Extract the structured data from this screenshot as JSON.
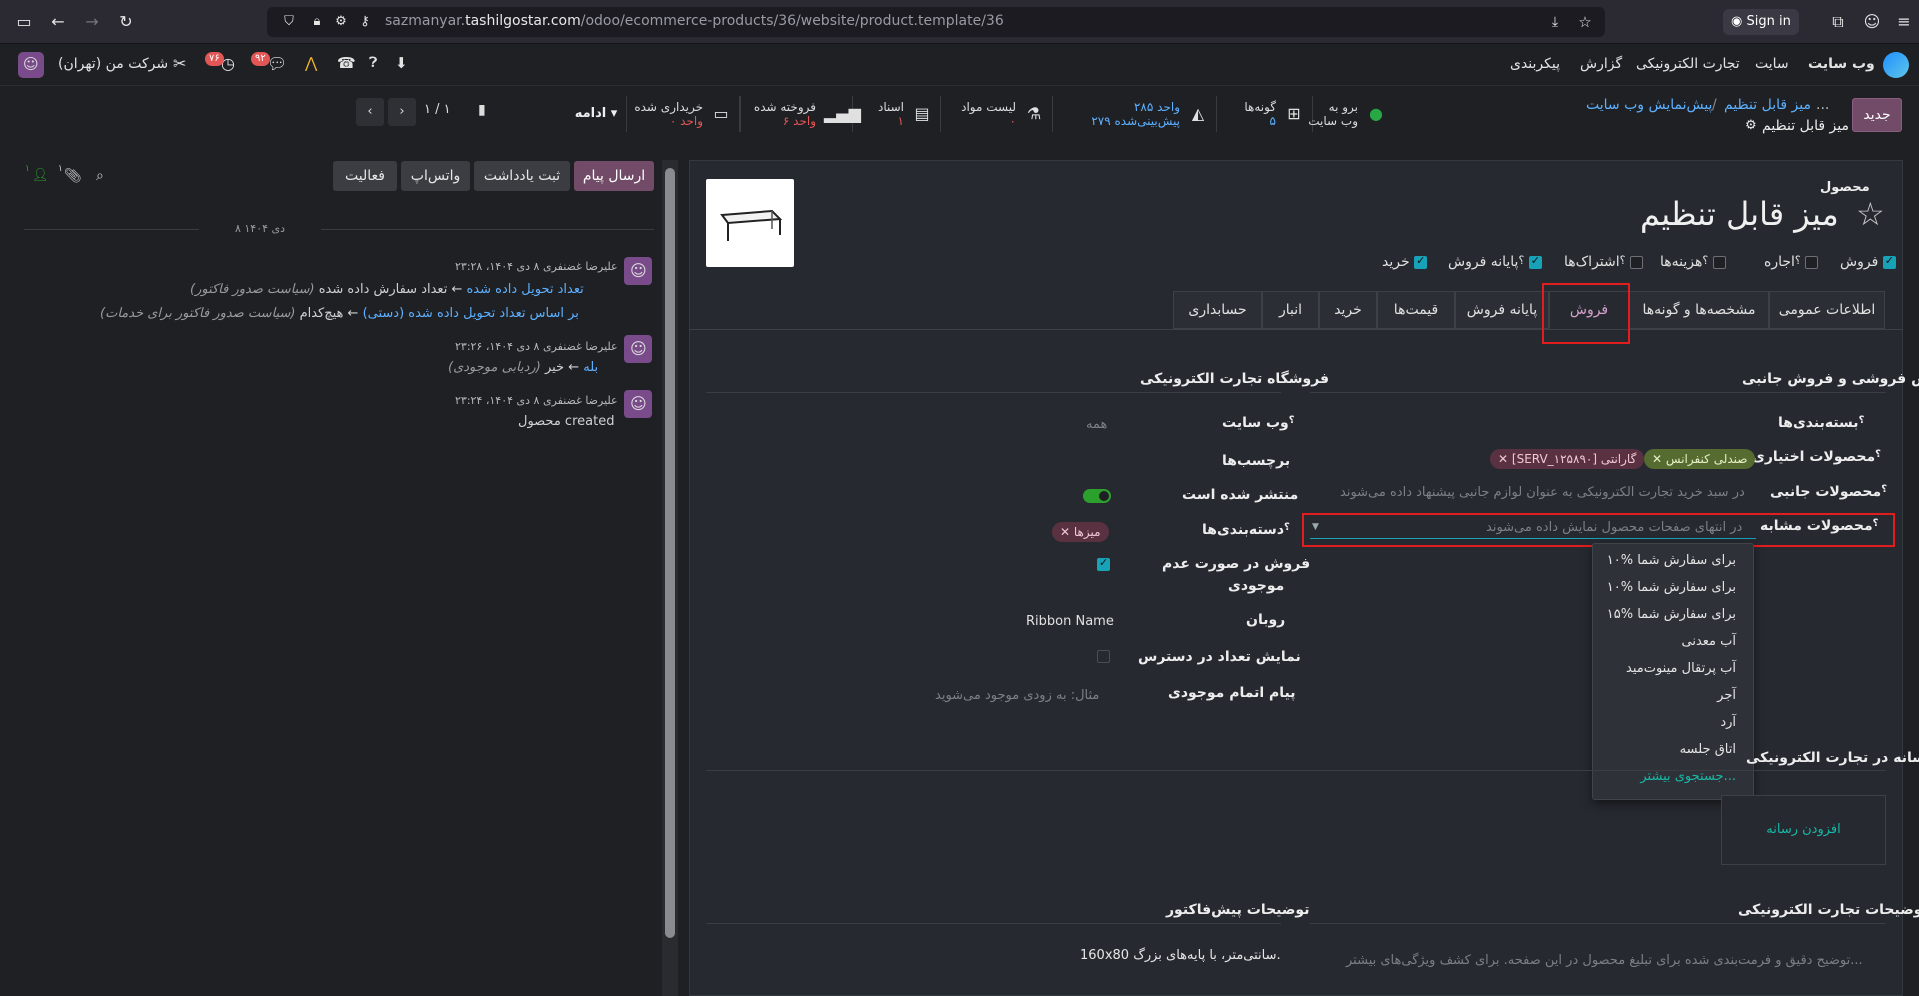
{
  "browser": {
    "url_prefix": "sazmanyar.",
    "url_domain": "tashilgostar.com",
    "url_path": "/odoo/ecommerce-products/36/website/product.template/36",
    "signin_label": "Sign in"
  },
  "appnav": {
    "app_name": "وب سایت",
    "menus": [
      "سایت",
      "تجارت الکترونیکی",
      "گزارش",
      "پیکربندی"
    ],
    "company": "شرکت من (تهران)",
    "badge_messages": "۹۲",
    "badge_activities": "۷۶"
  },
  "control": {
    "new_button": "جدید",
    "breadcrumb_1": "...",
    "breadcrumb_2": "میز قابل تنظیم",
    "breadcrumb_3": "پیش‌نمایش وب سایت",
    "record_title": "میز قابل تنظیم",
    "pager": "۱ / ۱",
    "stat_buttons": [
      {
        "line1": "برو به",
        "line2": "وب سایت",
        "icon": "globe-icon"
      },
      {
        "line1": "گونه‌ها",
        "line2": "۵",
        "icon": "sitemap-icon"
      },
      {
        "line1": "۲۸۵ واحد",
        "line2": "۲۷۹ پیش‌بینی‌شده",
        "icon": "area-chart-icon"
      },
      {
        "line1": "لیست مواد",
        "line2": "۰",
        "icon": "flask-icon"
      },
      {
        "line1": "اسناد",
        "line2": "۱",
        "icon": "document-icon"
      },
      {
        "line1": "فروخته شده",
        "line2": "۶ واحد",
        "icon": "signal-icon"
      },
      {
        "line1": "خریداری شده",
        "line2": "۰ واحد",
        "icon": "credit-card-icon"
      }
    ],
    "more_button": "ادامه"
  },
  "form": {
    "product_type_label": "محصول",
    "name": "میز قابل تنظیم",
    "options": [
      {
        "label": "فروش",
        "checked": true
      },
      {
        "label": "اجاره",
        "checked": false
      },
      {
        "label": "هزینه‌ها",
        "checked": false
      },
      {
        "label": "اشتراک‌ها",
        "checked": false
      },
      {
        "label": "پایانه فروش",
        "checked": true
      },
      {
        "label": "خرید",
        "checked": true
      }
    ],
    "tabs": [
      "اطلاعات عمومی",
      "مشخصه‌ها و گونه‌ها",
      "فروش",
      "پایانه فروش",
      "قیمت‌ها",
      "خرید",
      "انبار",
      "حسابداری"
    ],
    "upsell": {
      "title": "پیش فروشی و فروش جانبی",
      "categories_label": "بسته‌بندی‌ها",
      "optional_label": "محصولات اختیاری",
      "optional_tags": [
        "صندلی کنفرانس",
        "[SERV_۱۲۵۸۹۰] گارانتی"
      ],
      "accessory_label": "محصولات جانبی",
      "accessory_placeholder": "در سبد خرید تجارت الکترونیکی به عنوان لوازم جانبی پیشنهاد داده می‌شوند",
      "similar_label": "محصولات مشابه",
      "similar_placeholder": "در انتهای صفحات محصول نمایش داده می‌شوند"
    },
    "ecommerce": {
      "title": "فروشگاه تجارت الکترونیکی",
      "website_label": "وب سایت",
      "website_value": "همه",
      "tags_label": "برچسب‌ها",
      "published_label": "منتشر شده است",
      "categories_label": "دسته‌بندی‌ها",
      "category_tag": "میزها",
      "oos_label_1": "فروش در صورت عدم",
      "oos_label_2": "موجودی",
      "ribbon_label": "روبان",
      "ribbon_value": "Ribbon Name",
      "show_qty_label": "نمایش تعداد در دسترس",
      "oos_msg_label": "پیام اتمام موجودی",
      "oos_msg_placeholder": "مثال: به زودی موجود می‌شوید"
    },
    "media": {
      "title": "رسانه در تجارت الکترونیکی",
      "add_button": "افزودن رسانه"
    },
    "ecom_desc": {
      "title": "توضیحات تجارت الکترونیکی",
      "placeholder": "توضیح دقیق و فرمت‌بندی شده برای تبلیغ محصول در این صفحه. برای کشف ویژگی‌های بیشتر..."
    },
    "quote_desc": {
      "title": "توضیحات پیش‌فاکتور",
      "value": "160x80 سانتی‌متر، با پایه‌های بزرگ."
    },
    "dropdown": [
      "۱۰% برای سفارش شما",
      "۱۰% برای سفارش شما",
      "۱۵% برای سفارش شما",
      "آب معدنی",
      "آب پرتقال مینوت‌مید",
      "آجر",
      "آرد",
      "اتاق جلسه",
      "جستجوی بیشتر..."
    ]
  },
  "chatter": {
    "send_message": "ارسال پیام",
    "log_note": "ثبت یادداشت",
    "whatsapp": "واتس‌اپ",
    "activity": "فعالیت",
    "attachments_count": "۱",
    "followers_count": "۱",
    "date_separator": "۸ دی ۱۴۰۴",
    "messages": [
      {
        "author": "علیرضا غضنفری ۸ دی ۱۴۰۴، ۲۳:۲۸",
        "line1_old": "تعداد سفارش داده شده",
        "line1_new": "تعداد تحویل داده شده",
        "line1_field": "(سیاست صدور فاکتور)",
        "line2_old": "هیچ‌کدام",
        "line2_new": "بر اساس تعداد تحویل داده شده (دستی)",
        "line2_field": "(سیاست صدور فاکتور برای خدمات)"
      },
      {
        "author": "علیرضا غضنفری ۸ دی ۱۴۰۴، ۲۳:۲۶",
        "line1_old": "خیر",
        "line1_new": "بله",
        "line1_field": "(ردیابی موجودی)"
      },
      {
        "author": "علیرضا غضنفری ۸ دی ۱۴۰۴، ۲۳:۲۴",
        "line1": "محصول created"
      }
    ]
  },
  "colors": {
    "accent": "#714B67",
    "link": "#5db0ff",
    "check": "#17a2b8",
    "highlight": "#e21d1d"
  }
}
